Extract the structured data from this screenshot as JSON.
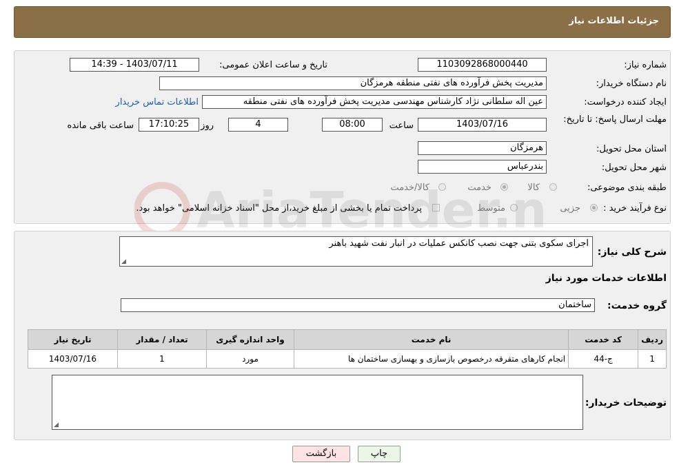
{
  "header": {
    "title": "جزئیات اطلاعات نیاز"
  },
  "info": {
    "need_number_label": "شماره نیاز:",
    "need_number": "1103092868000440",
    "announce_label": "تاریخ و ساعت اعلان عمومی:",
    "announce_value": "1403/07/11 - 14:39",
    "buyer_org_label": "نام دستگاه خریدار:",
    "buyer_org": "مدیریت پخش فرآورده های نفتی منطقه هرمزگان",
    "creator_label": "ایجاد کننده درخواست:",
    "creator": "عین اله سلطانی نژاد کارشناس مهندسی مدیریت پخش فرآورده های نفتی منطقه",
    "contact_link": "اطلاعات تماس خریدار",
    "deadline_label": "مهلت ارسال پاسخ: تا تاریخ:",
    "deadline_date": "1403/07/16",
    "time_label": "ساعت",
    "deadline_time": "08:00",
    "days_value": "4",
    "days_label": "روز و",
    "remaining_value": "17:10:25",
    "remaining_label": "ساعت باقی مانده",
    "province_label": "استان محل تحویل:",
    "province": "هرمزگان",
    "city_label": "شهر محل تحویل:",
    "city": "بندرعباس",
    "category_label": "طبقه بندی موضوعی:",
    "category_options": [
      {
        "label": "کالا",
        "selected": false
      },
      {
        "label": "خدمت",
        "selected": true
      },
      {
        "label": "کالا/خدمت",
        "selected": false
      }
    ],
    "process_label": "نوع فرآیند خرید :",
    "process_options": [
      {
        "label": "جزیی",
        "selected": true
      },
      {
        "label": "متوسط",
        "selected": false
      }
    ],
    "payment_note": "پرداخت تمام یا بخشی از مبلغ خرید،از محل \"اسناد خزانه اسلامی\" خواهد بود."
  },
  "details": {
    "summary_label": "شرح کلی نیاز:",
    "summary": "اجرای سکوی بتنی جهت نصب کانکس عملیات در انبار نفت شهید باهنر",
    "services_heading": "اطلاعات خدمات مورد نیاز",
    "service_group_label": "گروه خدمت:",
    "service_group": "ساختمان",
    "table": {
      "headers": [
        "ردیف",
        "کد خدمت",
        "نام خدمت",
        "واحد اندازه گیری",
        "تعداد / مقدار",
        "تاریخ نیاز"
      ],
      "rows": [
        [
          "1",
          "ج-44",
          "انجام کارهای متفرقه درخصوص بازسازی و بهسازی ساختمان ها",
          "مورد",
          "1",
          "1403/07/16"
        ]
      ]
    },
    "buyer_notes_label": "توضیحات خریدار:",
    "buyer_notes": ""
  },
  "buttons": {
    "print": "چاپ",
    "back": "بازگشت"
  },
  "watermark": "AriaTender.neT"
}
